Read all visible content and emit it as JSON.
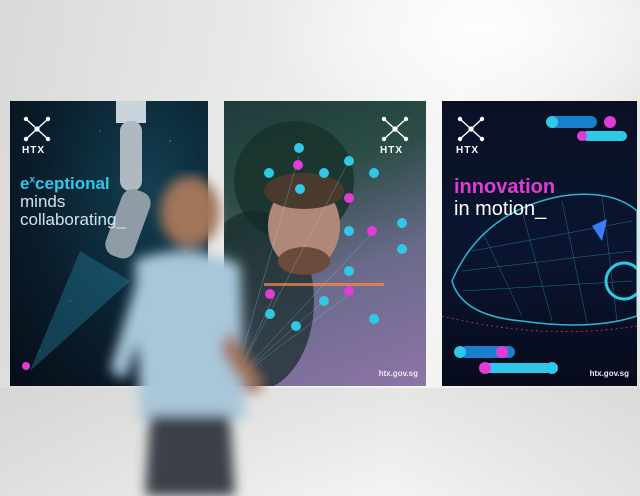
{
  "scene": {
    "background": "#ececea"
  },
  "posters": [
    {
      "logo_text": "HTX",
      "headline_accent": "exceptional",
      "headline_sup": "x",
      "headline_line2": "minds",
      "headline_line3": "collaborating_",
      "accent_color": "#33c6e8"
    },
    {
      "logo_text": "HTX",
      "url": "htx.gov.sg",
      "dot_colors": [
        "#2fc8e6",
        "#e23bd6"
      ]
    },
    {
      "logo_text": "HTX",
      "headline_accent": "innovation",
      "headline_line2": "in motion_",
      "url": "htx.gov.sg",
      "accent_color": "#e23bd6"
    }
  ]
}
